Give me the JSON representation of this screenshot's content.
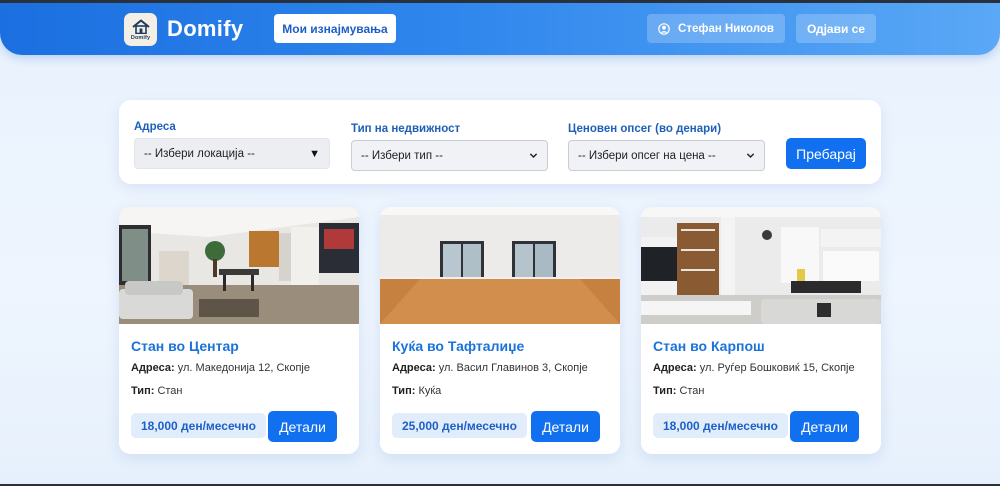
{
  "header": {
    "logo_text": "Domify",
    "brand": "Domify",
    "my_rentals_label": "Мои изнајмувања",
    "user_name": "Стефан Николов",
    "logout_label": "Одјави се"
  },
  "search": {
    "address_label": "Адреса",
    "address_value": "-- Избери локација --",
    "type_label": "Тип на недвижност",
    "type_value": "-- Избери тип --",
    "price_label": "Ценовен опсег (во денари)",
    "price_value": "-- Избери опсег на цена --",
    "submit_label": "Пребарај"
  },
  "listings": [
    {
      "title": "Стан во Центар",
      "address_label": "Адреса:",
      "address": "ул. Македонија 12, Скопје",
      "type_label": "Тип:",
      "type": "Стан",
      "price": "18,000 ден/месечно",
      "details_label": "Детали"
    },
    {
      "title": "Куќа во Тафталиџе",
      "address_label": "Адреса:",
      "address": "ул. Васил Главинов 3, Скопје",
      "type_label": "Тип:",
      "type": "Куќа",
      "price": "25,000 ден/месечно",
      "details_label": "Детали"
    },
    {
      "title": "Стан во Карпош",
      "address_label": "Адреса:",
      "address": "ул. Руѓер Бошковиќ 15, Скопје",
      "type_label": "Тип:",
      "type": "Стан",
      "price": "18,000 ден/месечно",
      "details_label": "Детали"
    }
  ],
  "colors": {
    "primary": "#1170f0",
    "header_start": "#1b6fe0",
    "header_end": "#5aa8f6",
    "title_blue": "#1a73d9",
    "pill_bg": "#e2edfb"
  },
  "icons": {
    "logo": "house-logo-icon",
    "user": "user-circle-icon",
    "address_caret": "caret-down-icon",
    "select_chevron": "chevron-down-icon"
  }
}
